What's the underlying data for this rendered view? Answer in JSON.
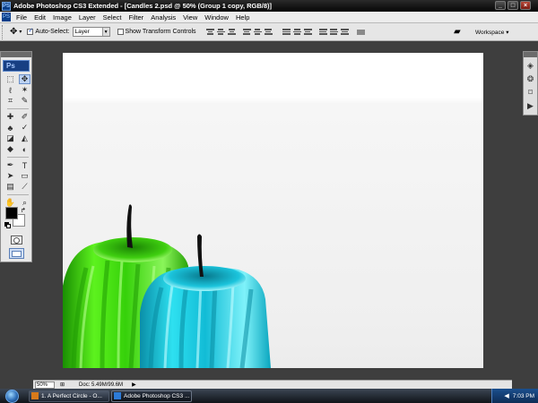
{
  "window": {
    "app_icon": "PS",
    "title": "Adobe Photoshop CS3 Extended - [Candles 2.psd @ 50% (Group 1 copy, RGB/8)]",
    "minimize": "_",
    "maximize": "□",
    "close": "×"
  },
  "menu": {
    "app_icon": "PS",
    "items": [
      "File",
      "Edit",
      "Image",
      "Layer",
      "Select",
      "Filter",
      "Analysis",
      "View",
      "Window",
      "Help"
    ]
  },
  "options": {
    "auto_select_label": "Auto-Select:",
    "auto_select_checked": true,
    "auto_select_value": "Layer",
    "show_transform_label": "Show Transform Controls",
    "show_transform_checked": false,
    "workspace_label": "Workspace ▾"
  },
  "toolbox": {
    "logo": "Ps",
    "tools": [
      {
        "name": "marquee-tool-icon",
        "glyph": "⬚"
      },
      {
        "name": "move-tool-icon",
        "glyph": "✥"
      },
      {
        "name": "lasso-tool-icon",
        "glyph": "ℓ"
      },
      {
        "name": "magic-wand-tool-icon",
        "glyph": "✶"
      },
      {
        "name": "crop-tool-icon",
        "glyph": "⌗"
      },
      {
        "name": "slice-tool-icon",
        "glyph": "✎"
      },
      {
        "name": "healing-brush-tool-icon",
        "glyph": "✚"
      },
      {
        "name": "brush-tool-icon",
        "glyph": "✐"
      },
      {
        "name": "clone-stamp-tool-icon",
        "glyph": "♣"
      },
      {
        "name": "history-brush-tool-icon",
        "glyph": "✓"
      },
      {
        "name": "eraser-tool-icon",
        "glyph": "◪"
      },
      {
        "name": "paint-bucket-tool-icon",
        "glyph": "◭"
      },
      {
        "name": "blur-tool-icon",
        "glyph": "◆"
      },
      {
        "name": "dodge-tool-icon",
        "glyph": "◐"
      },
      {
        "name": "pen-tool-icon",
        "glyph": "✒"
      },
      {
        "name": "type-tool-icon",
        "glyph": "T"
      },
      {
        "name": "path-selection-tool-icon",
        "glyph": "➤"
      },
      {
        "name": "shape-tool-icon",
        "glyph": "▭"
      },
      {
        "name": "notes-tool-icon",
        "glyph": "▤"
      },
      {
        "name": "eyedropper-tool-icon",
        "glyph": "⟋"
      },
      {
        "name": "hand-tool-icon",
        "glyph": "✋"
      },
      {
        "name": "zoom-tool-icon",
        "glyph": "⌕"
      }
    ],
    "selected_tool": "move-tool-icon"
  },
  "status": {
    "zoom": "50%",
    "doc": "Doc: 5.49M/99.6M"
  },
  "taskbar": {
    "items": [
      {
        "label": "1. A Perfect Circle - O...",
        "active": false
      },
      {
        "label": "Adobe Photoshop CS3 ...",
        "active": true
      }
    ],
    "clock": "7:03 PM"
  },
  "colors": {
    "green_candle": "#3fdc0a",
    "blue_candle": "#16c8dc",
    "accent": "#1b4f8e"
  }
}
